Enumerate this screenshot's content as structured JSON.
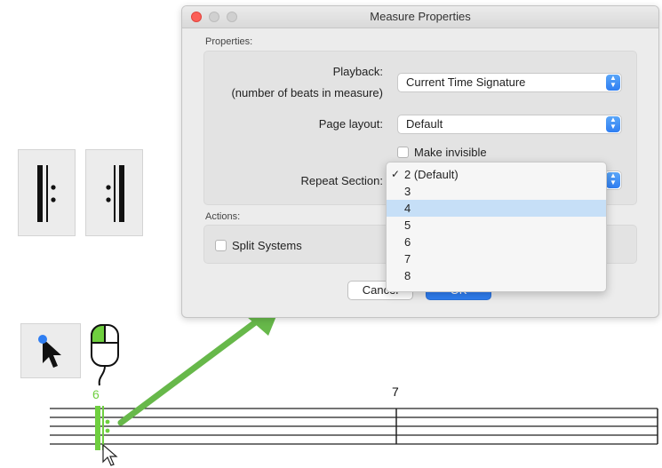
{
  "dialog": {
    "title": "Measure Properties",
    "properties_label": "Properties:",
    "playback_label": "Playback:",
    "playback_sublabel": "(number of beats in measure)",
    "playback_value": "Current Time Signature",
    "page_layout_label": "Page layout:",
    "page_layout_value": "Default",
    "make_invisible_label": "Make invisible",
    "repeat_section_label": "Repeat Section:",
    "actions_label": "Actions:",
    "split_systems_label": "Split Systems",
    "cancel_label": "Cancel",
    "ok_label": "OK"
  },
  "repeat_menu": {
    "items": [
      "2 (Default)",
      "3",
      "4",
      "5",
      "6",
      "7",
      "8"
    ],
    "checked_item": "2 (Default)",
    "highlighted_item": "4"
  },
  "score": {
    "measure_numbers": [
      "6",
      "7"
    ]
  },
  "icons": [
    "start-repeat-icon",
    "end-repeat-icon",
    "selection-arrow-icon",
    "mouse-left-click-icon",
    "mouse-pointer-icon",
    "green-arrow-icon"
  ],
  "colors": {
    "accent": "#2f7ef2",
    "highlight": "#c6dff7",
    "selection_green": "#6fcf3f",
    "arrow_green": "#67b84a"
  }
}
